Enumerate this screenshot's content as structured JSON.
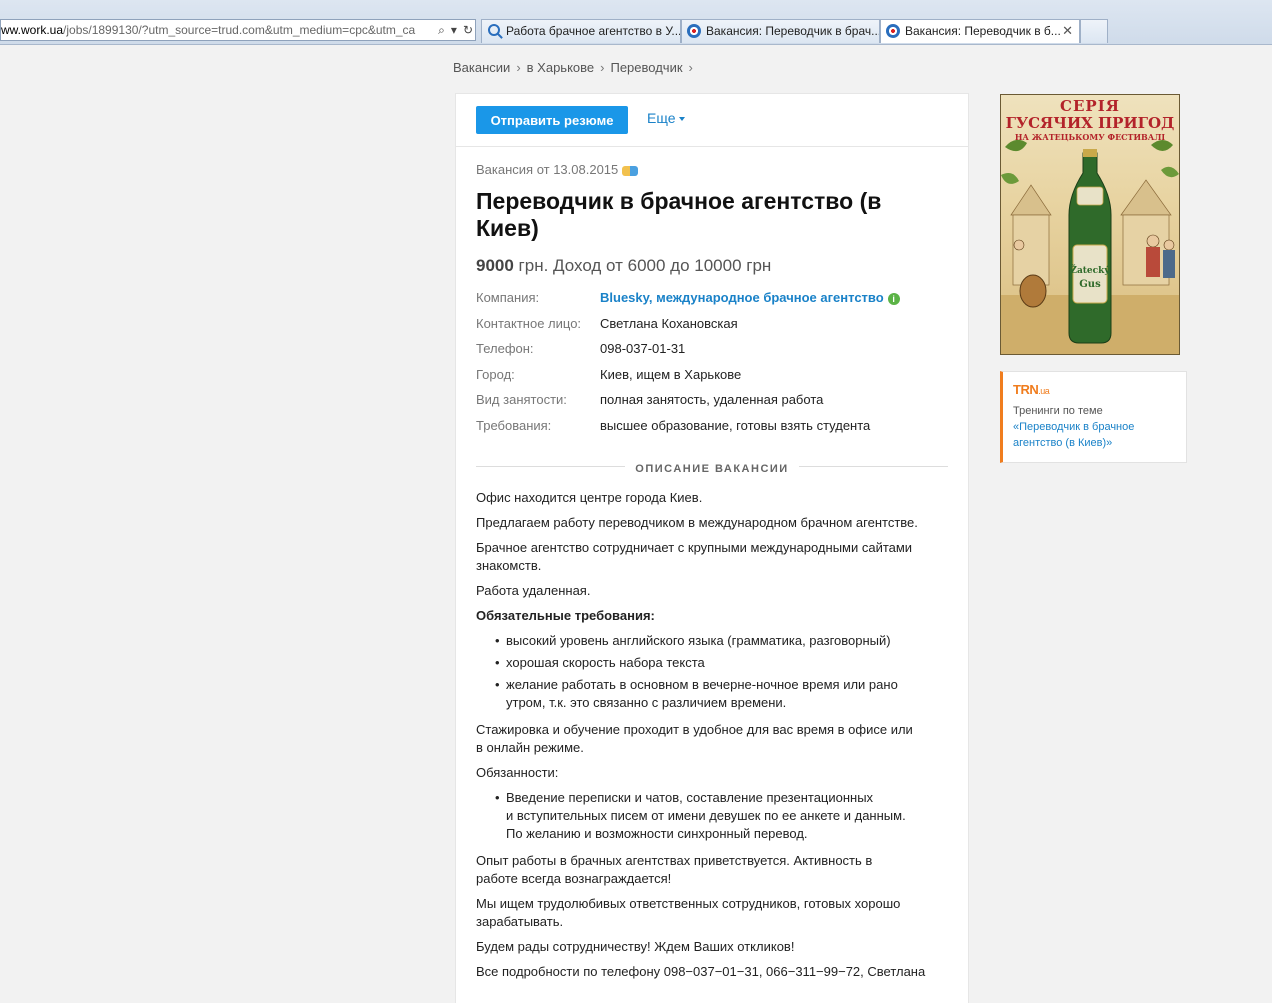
{
  "browser": {
    "url_host": "ww.work.ua",
    "url_rest": "/jobs/1899130/?utm_source=trud.com&utm_medium=cpc&utm_ca",
    "tabs": [
      {
        "label": "Работа брачное агентство в У...",
        "icon": "search-icon",
        "active": false
      },
      {
        "label": "Вакансия: Переводчик в брач...",
        "icon": "target-icon",
        "active": false
      },
      {
        "label": "Вакансия: Переводчик в б...",
        "icon": "target-icon",
        "active": true
      }
    ],
    "close_glyph": "✕"
  },
  "breadcrumb": [
    "Вакансии",
    "в Харькове",
    "Переводчик"
  ],
  "toolbar": {
    "send_label": "Отправить резюме",
    "more_label": "Еще"
  },
  "job": {
    "posted": "Вакансия от 13.08.2015",
    "title": "Переводчик в брачное агентство (в Киев)",
    "salary_amount": "9000",
    "salary_rest": " грн. Доход от 6000 до 10000 грн",
    "info": [
      {
        "key": "Компания:",
        "value": "Bluesky, международное брачное агентство"
      },
      {
        "key": "Контактное лицо:",
        "value": "Светлана Кохановская"
      },
      {
        "key": "Телефон:",
        "value": "098-037-01-31"
      },
      {
        "key": "Город:",
        "value": "Киев, ищем в Харькове"
      },
      {
        "key": "Вид занятости:",
        "value": "полная занятость, удаленная работа"
      },
      {
        "key": "Требования:",
        "value": "высшее образование, готовы взять студента"
      }
    ],
    "desc_header": "ОПИСАНИЕ ВАКАНСИИ",
    "desc": {
      "p1": "Офис находится центре города Киев.",
      "p2": "Предлагаем работу переводчиком в международном брачном агентстве.",
      "p3": "Брачное агентство сотрудничает с крупными международными сайтами знакомств.",
      "p4": "Работа удаленная.",
      "req_title": "Обязательные требования:",
      "req": [
        "высокий уровень английского языка (грамматика, разговорный)",
        "хорошая скорость набора текста",
        "желание работать в основном в вечерне-ночное время или рано утром, т.к. это связанно с различием времени."
      ],
      "p5": "Стажировка и обучение проходит в удобное для вас время в офисе или в онлайн режиме.",
      "duties_title": "Обязанности:",
      "duties_l1": "Введение переписки и чатов, составление презентационных",
      "duties_l2": "и вступительных писем от имени девушек по ее анкете и данным.",
      "duties_l3": "По желанию и возможности синхронный перевод.",
      "p6": "Опыт работы в брачных агентствах приветствуется. Активность в работе всегда вознаграждается!",
      "p7": "Мы ищем трудолюбивых ответственных сотрудников, готовых хорошо зарабатывать.",
      "p8": "Будем рады сотрудничеству! Ждем Ваших откликов!",
      "p9": "Все подробности по телефону 098−037−01−31, 066−311−99−72, Светлана"
    }
  },
  "ad": {
    "line1": "СЕРІЯ",
    "line2": "ГУСЯЧИХ ПРИГОД",
    "line3": "НА ЖАТЕЦЬКОМУ ФЕСТИВАЛІ",
    "bottle_label_1": "Žatecký",
    "bottle_label_2": "Gus"
  },
  "trn": {
    "logo": "TRN",
    "logo_suffix": ".ua",
    "text_prefix": "Тренинги по теме",
    "link": "«Переводчик в брачное агентство (в Киев)»"
  },
  "colors": {
    "primary_button": "#1a97e8",
    "link": "#1a82c8",
    "trn_accent": "#f07d1e"
  }
}
